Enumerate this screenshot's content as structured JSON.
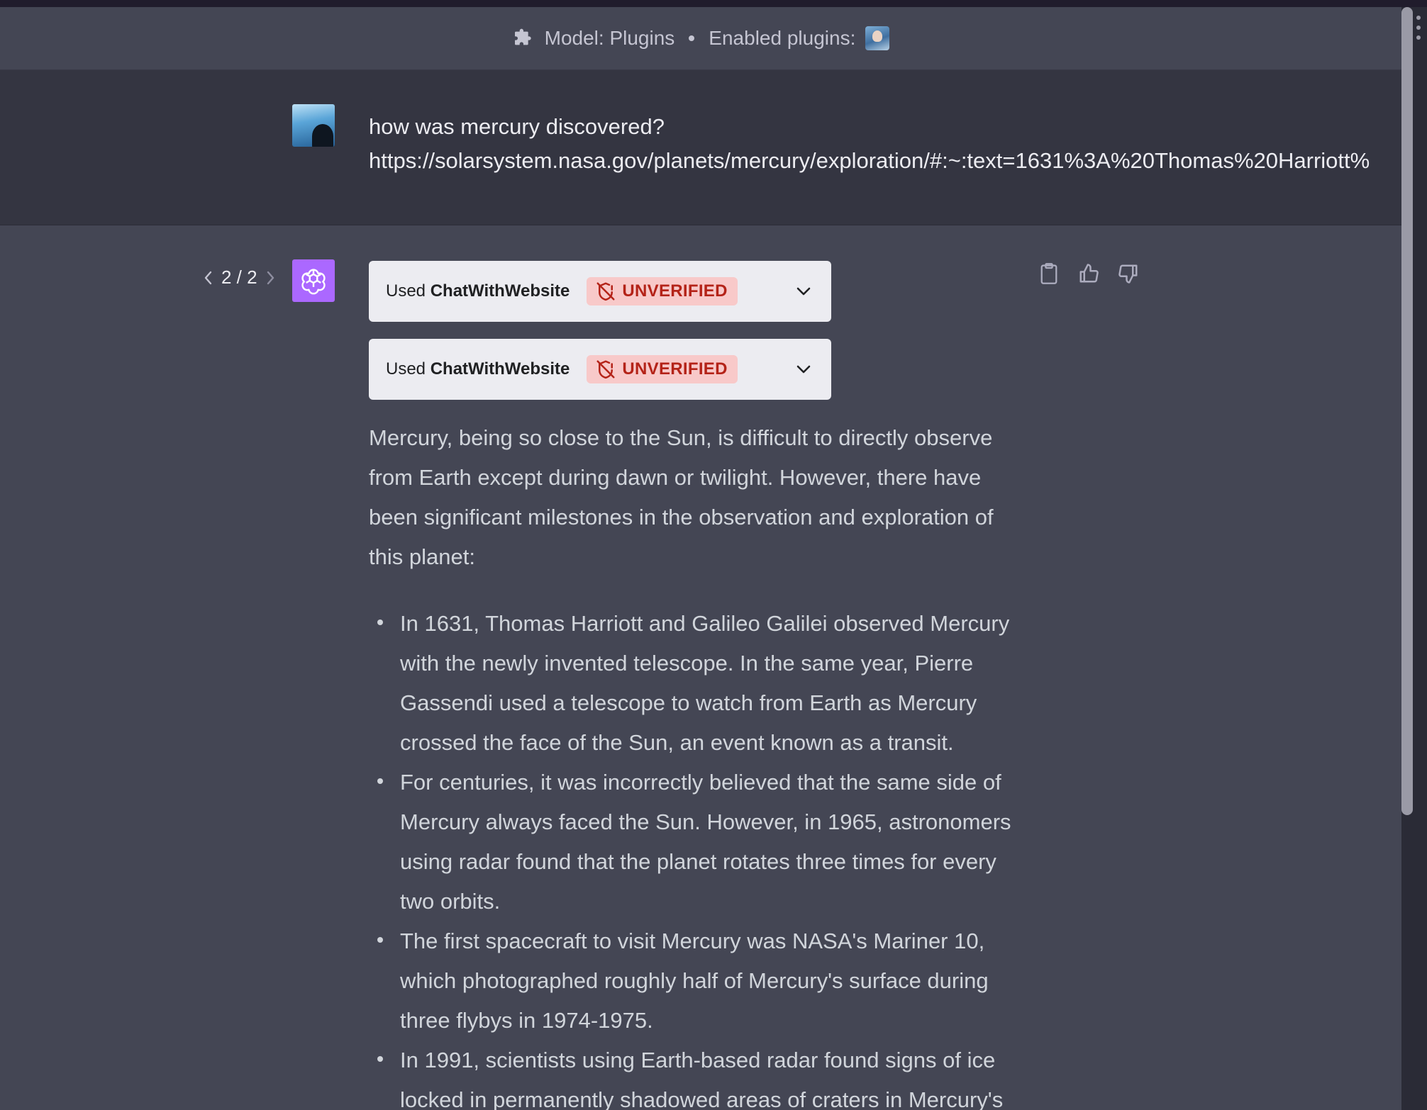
{
  "header": {
    "model_label": "Model: Plugins",
    "enabled_label": "Enabled plugins:"
  },
  "user_message": {
    "line1": "how was mercury discovered?",
    "line2": "https://solarsystem.nasa.gov/planets/mercury/exploration/#:~:text=1631%3A%20Thomas%20Harriott%"
  },
  "assistant": {
    "pager": "2 / 2",
    "plugin_calls": [
      {
        "used_prefix": "Used",
        "plugin_name": "ChatWithWebsite",
        "badge": "UNVERIFIED"
      },
      {
        "used_prefix": "Used",
        "plugin_name": "ChatWithWebsite",
        "badge": "UNVERIFIED"
      }
    ],
    "intro": "Mercury, being so close to the Sun, is difficult to directly observe from Earth except during dawn or twilight. However, there have been significant milestones in the observation and exploration of this planet:",
    "bullets": [
      "In 1631, Thomas Harriott and Galileo Galilei observed Mercury with the newly invented telescope. In the same year, Pierre Gassendi used a telescope to watch from Earth as Mercury crossed the face of the Sun, an event known as a transit.",
      "For centuries, it was incorrectly believed that the same side of Mercury always faced the Sun. However, in 1965, astronomers using radar found that the planet rotates three times for every two orbits.",
      "The first spacecraft to visit Mercury was NASA's Mariner 10, which photographed roughly half of Mercury's surface during three flybys in 1974-1975.",
      "In 1991, scientists using Earth-based radar found signs of ice locked in permanently shadowed areas of craters in Mercury's"
    ]
  },
  "colors": {
    "background": "#444654",
    "user_background": "#343541",
    "gpt_avatar": "#ab68ff",
    "badge_bg": "#f8c9c9",
    "badge_text": "#b42318"
  },
  "icons": [
    "puzzle-icon",
    "plugin-avatar",
    "chevron-left-icon",
    "chevron-right-icon",
    "openai-logo-icon",
    "shield-off-icon",
    "chevron-down-icon",
    "clipboard-icon",
    "thumbs-up-icon",
    "thumbs-down-icon"
  ]
}
